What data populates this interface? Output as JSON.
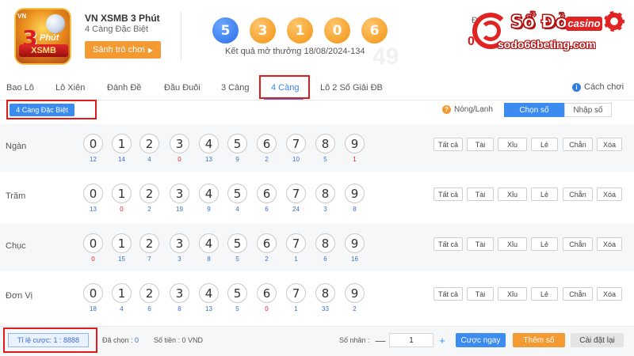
{
  "header": {
    "badge": {
      "vn": "VN",
      "phut": "Phút",
      "xsmb": "XSMB"
    },
    "game_title": "VN XSMB 3 Phút",
    "game_subtitle": "4 Càng Đặc Biệt",
    "play_button": "Sảnh trò chơi",
    "result_balls": [
      "5",
      "3",
      "1",
      "0",
      "6"
    ],
    "result_ball_colors": [
      "#2a6ee8",
      "#f29414",
      "#f29414",
      "#f29414",
      "#f29414"
    ],
    "result_text": "Kết quả mở thưởng 18/08/2024-134",
    "faint_number": "49",
    "faint_label": "Đ",
    "faint_red": "0"
  },
  "casino_logo": {
    "brand": "Sổ Đỏ",
    "casino": "casino",
    "site": "sodo66beting.com",
    "color": "#e02424"
  },
  "tabs": [
    "Bao Lô",
    "Lô Xiên",
    "Đánh Đề",
    "Đầu Đuôi",
    "3 Càng",
    "4 Càng",
    "Lô 2 Số Giải ĐB"
  ],
  "active_tab": "4 Càng",
  "help_label": "Cách chơi",
  "subtab": "4 Càng Đặc Biệt",
  "hot_cold_label": "Nóng/Lạnh",
  "mode": {
    "selected": "Chọn số",
    "other": "Nhập số"
  },
  "digits": [
    "0",
    "1",
    "2",
    "3",
    "4",
    "5",
    "6",
    "7",
    "8",
    "9"
  ],
  "quick_buttons": [
    "Tất cả",
    "Tài",
    "Xỉu",
    "Lẻ",
    "Chẵn",
    "Xóa"
  ],
  "rows": [
    {
      "label": "Ngàn",
      "counts": [
        "12",
        "14",
        "4",
        "0",
        "13",
        "9",
        "2",
        "10",
        "5",
        "1"
      ]
    },
    {
      "label": "Trăm",
      "counts": [
        "13",
        "0",
        "2",
        "19",
        "9",
        "4",
        "6",
        "24",
        "3",
        "8"
      ]
    },
    {
      "label": "Chục",
      "counts": [
        "0",
        "15",
        "7",
        "3",
        "8",
        "5",
        "2",
        "1",
        "6",
        "16"
      ]
    },
    {
      "label": "Đơn Vị",
      "counts": [
        "18",
        "4",
        "6",
        "8",
        "13",
        "5",
        "0",
        "1",
        "33",
        "2"
      ]
    }
  ],
  "footer": {
    "odds": "Tỉ lệ cược: 1 : 8888",
    "selected_label": "Đã chọn :",
    "selected_value": "0",
    "amount_label": "Số tiền :",
    "amount_value": "0 VND",
    "multiplier_label": "Số nhân :",
    "multiplier_value": "1",
    "minus": "—",
    "plus": "+",
    "bet_now": "Cược ngay",
    "add_number": "Thêm số",
    "reset": "Cài đặt lại"
  },
  "colors": {
    "accent": "#3b8bf0",
    "orange": "#f39a32",
    "highlight": "#e01b1b"
  }
}
